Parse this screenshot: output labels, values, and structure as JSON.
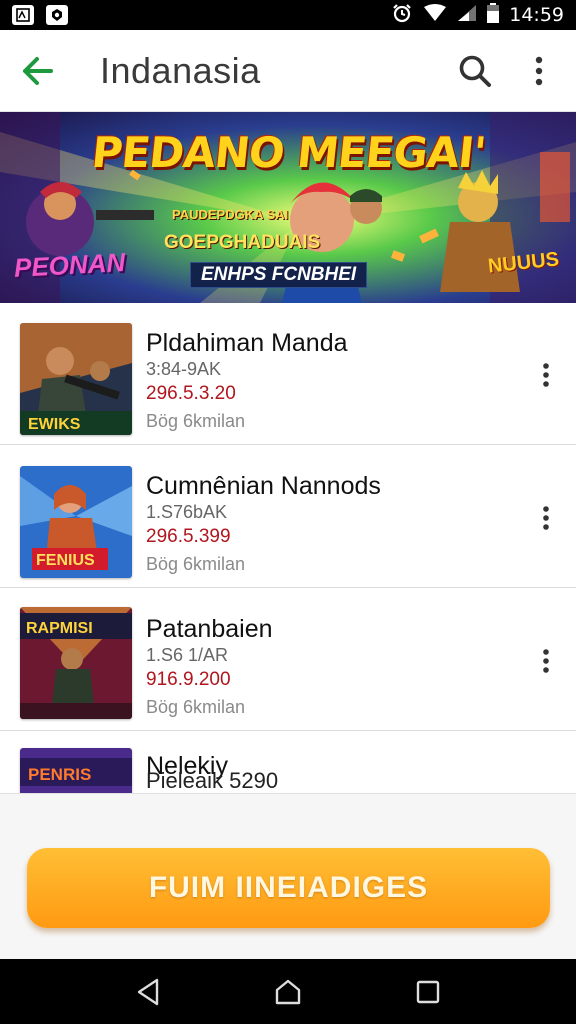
{
  "status_bar": {
    "time": "14:59"
  },
  "app_bar": {
    "title": "Indanasia"
  },
  "banner": {
    "headline": "PEDANO MEEGAI'",
    "sub1": "PAUDEPDGKA SAI",
    "sub2": "GOEPGHADUAIS",
    "tagline": "ENHPS FCNBHEI",
    "logo_left": "PEONAN",
    "logo_right": "NUUUS"
  },
  "games": [
    {
      "title": "Pldahiman Manda",
      "meta": "3:84-9AK",
      "price": "296.5.3.20",
      "sub": "Bög 6kmilan",
      "thumb_label": "EWIKS"
    },
    {
      "title": "Cumnênian Nannods",
      "meta": "1.S76bAK",
      "price": "296.5.399",
      "sub": "Bög 6kmilan",
      "thumb_label": "FENIUS"
    },
    {
      "title": "Patanbaien",
      "meta": "1.S6 1/AR",
      "price": "916.9.200",
      "sub": "Bög 6kmilan",
      "thumb_label": "RAPMISI"
    },
    {
      "title": "Nelekiy",
      "meta": "Pieleaik 5290",
      "price": "",
      "sub": "",
      "thumb_label": "PENRIS"
    }
  ],
  "cta": {
    "label": "FUIM IINEIADIGES"
  },
  "colors": {
    "accent_green": "#1e9a3e",
    "cta_orange": "#ffa31f",
    "price_red": "#b0161e"
  }
}
